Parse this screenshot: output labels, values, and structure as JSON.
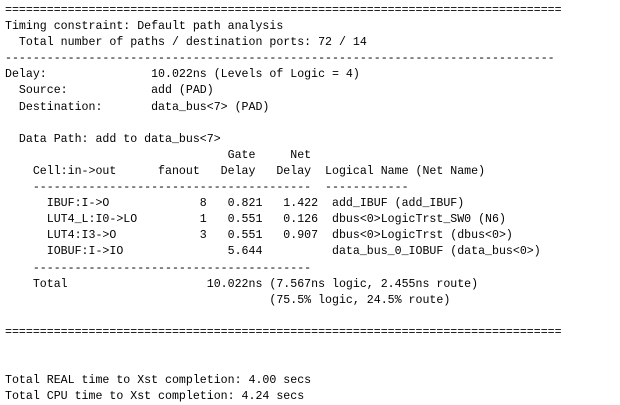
{
  "report": {
    "rule_top": "================================================================================",
    "title": "Timing constraint: Default path analysis",
    "total_paths": "  Total number of paths / destination ports: 72 / 14",
    "rule_dash_1": "-------------------------------------------------------------------------------",
    "delay": "Delay:               10.022ns (Levels of Logic = 4)",
    "source": "  Source:            add (PAD)",
    "destination": "  Destination:       data_bus<7> (PAD)",
    "blank_1": "",
    "data_path": "  Data Path: add to data_bus<7>",
    "header_1": "                                Gate     Net",
    "header_2": "    Cell:in->out      fanout   Delay   Delay  Logical Name (Net Name)",
    "header_rule": "    ----------------------------------------  ------------",
    "rows": [
      "      IBUF:I->O             8   0.821   1.422  add_IBUF (add_IBUF)",
      "      LUT4_L:I0->LO         1   0.551   0.126  dbus<0>LogicTrst_SW0 (N6)",
      "      LUT4:I3->O            3   0.551   0.907  dbus<0>LogicTrst (dbus<0>)",
      "      IOBUF:I->IO               5.644          data_bus_0_IOBUF (data_bus<0>)"
    ],
    "table_rule": "    ----------------------------------------",
    "total": "    Total                    10.022ns (7.567ns logic, 2.455ns route)",
    "total_pct": "                                      (75.5% logic, 24.5% route)",
    "blank_2": "",
    "rule_bottom": "================================================================================",
    "blank_3": "",
    "blank_4": "",
    "real_time": "Total REAL time to Xst completion: 4.00 secs",
    "cpu_time": "Total CPU time to Xst completion: 4.24 secs"
  }
}
